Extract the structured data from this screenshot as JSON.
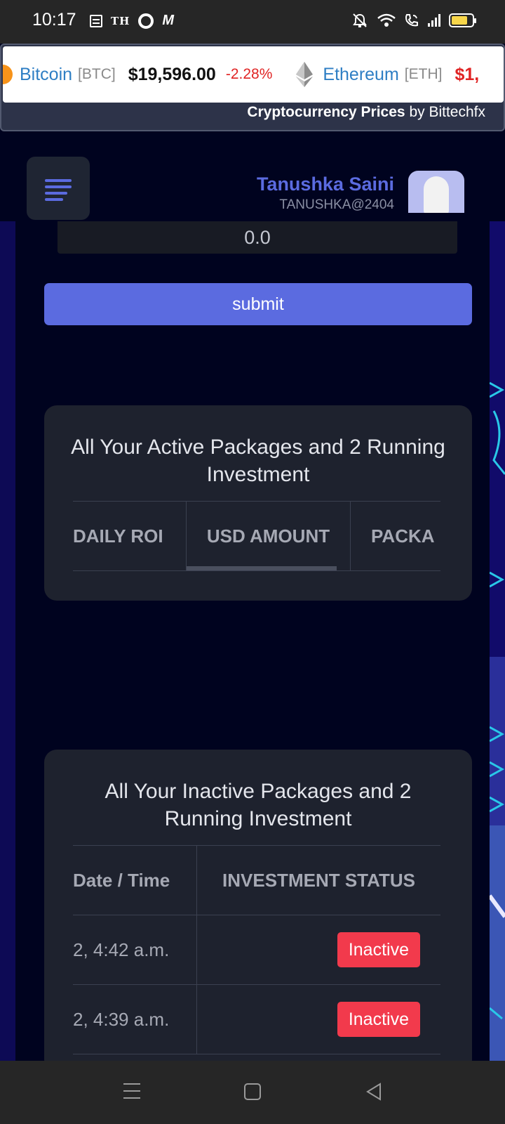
{
  "status_bar": {
    "time": "10:17",
    "left_icons": [
      "message-icon",
      "th-app-icon",
      "ring-app-icon",
      "m-app-icon"
    ],
    "right_icons": [
      "mute-icon",
      "wifi-icon",
      "wifi-calling-icon",
      "signal-icon",
      "battery-icon"
    ],
    "th_label": "TH",
    "m_label": "M",
    "battery_level": 0.8,
    "battery_color": "#f7d64a"
  },
  "ticker": {
    "items": [
      {
        "name": "Bitcoin",
        "symbol": "[BTC]",
        "price": "$19,596.00",
        "change": "-2.28%"
      },
      {
        "name": "Ethereum",
        "symbol": "[ETH]",
        "price": "$1,"
      }
    ],
    "footer_bold": "Cryptocurrency Prices",
    "footer_rest": " by Bittechfx"
  },
  "header": {
    "user_name": "Tanushka Saini",
    "user_id": "TANUSHKA@2404"
  },
  "form": {
    "amount_value": "0.0",
    "submit_label": "submit"
  },
  "active_card": {
    "title": "All Your Active Packages and 2 Running Investment",
    "columns": [
      "DAILY ROI",
      "USD AMOUNT",
      "PACKA"
    ]
  },
  "inactive_card": {
    "title": "All Your Inactive Packages and 2 Running Investment",
    "columns": [
      "Date / Time",
      "INVESTMENT STATUS"
    ],
    "rows": [
      {
        "date": "2, 4:42 a.m.",
        "status": "Inactive"
      },
      {
        "date": "2, 4:39 a.m.",
        "status": "Inactive"
      }
    ]
  },
  "colors": {
    "accent": "#5b6be0",
    "background": "#00031f",
    "card": "#1e222e",
    "danger": "#f23a4c"
  }
}
